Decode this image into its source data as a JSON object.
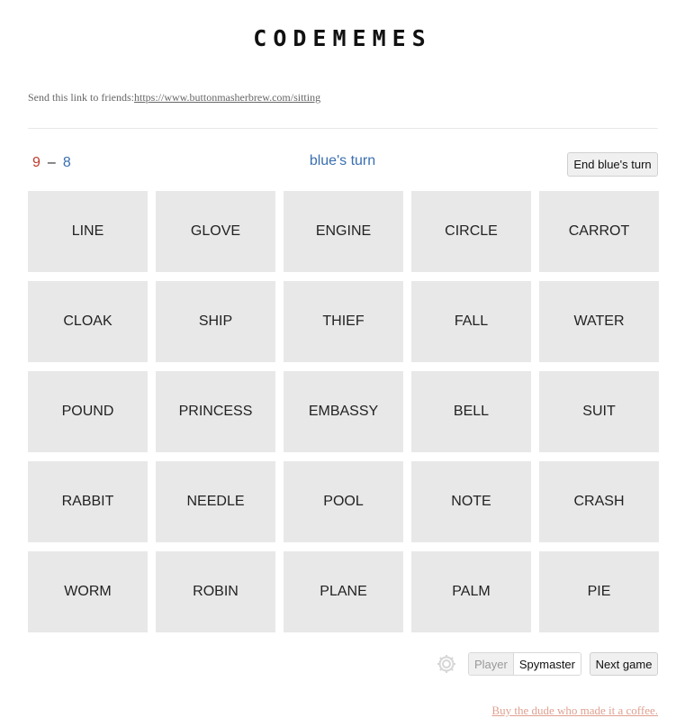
{
  "app": {
    "title": "CODEMEMES"
  },
  "share": {
    "label": "Send this link to friends:",
    "link": "https://www.buttonmasherbrew.com/sitting"
  },
  "score": {
    "red": "9",
    "separator": "–",
    "blue": "8"
  },
  "turn": {
    "text": "blue's turn"
  },
  "buttons": {
    "end_turn": "End blue's turn",
    "next_game": "Next game"
  },
  "mode": {
    "player": "Player",
    "spymaster": "Spymaster",
    "selected": "Spymaster"
  },
  "board": {
    "words": [
      "LINE",
      "GLOVE",
      "ENGINE",
      "CIRCLE",
      "CARROT",
      "CLOAK",
      "SHIP",
      "THIEF",
      "FALL",
      "WATER",
      "POUND",
      "PRINCESS",
      "EMBASSY",
      "BELL",
      "SUIT",
      "RABBIT",
      "NEEDLE",
      "POOL",
      "NOTE",
      "CRASH",
      "WORM",
      "ROBIN",
      "PLANE",
      "PALM",
      "PIE"
    ]
  },
  "footer": {
    "coffee_link": "Buy the dude who made it a coffee."
  },
  "colors": {
    "red_team": "#c0392b",
    "blue_team": "#3a6fb0",
    "card_bg": "#e8e8e8",
    "link_coffee": "#e0a090"
  },
  "icons": {
    "settings": "gear-icon"
  }
}
